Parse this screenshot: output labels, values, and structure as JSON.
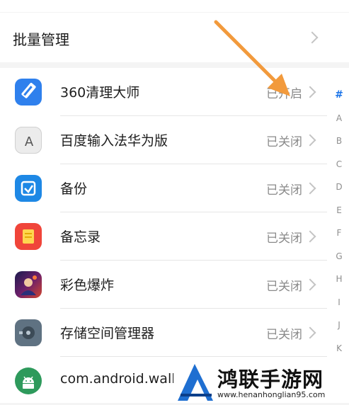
{
  "batch": {
    "label": "批量管理"
  },
  "apps": [
    {
      "name": "360清理大师",
      "status": "已开启",
      "icon": "broom-icon"
    },
    {
      "name": "百度输入法华为版",
      "status": "已关闭",
      "icon": "keyboard-a-icon"
    },
    {
      "name": "备份",
      "status": "已关闭",
      "icon": "backup-icon"
    },
    {
      "name": "备忘录",
      "status": "已关闭",
      "icon": "notepad-icon"
    },
    {
      "name": "彩色爆炸",
      "status": "已关闭",
      "icon": "game-icon"
    },
    {
      "name": "存储空间管理器",
      "status": "已关闭",
      "icon": "storage-icon"
    },
    {
      "name": "com.android.wall",
      "status": "",
      "icon": "android-icon"
    }
  ],
  "index_letters": [
    "#",
    "A",
    "B",
    "C",
    "D",
    "E",
    "F",
    "G",
    "H",
    "I",
    "J",
    "K"
  ],
  "watermark": {
    "text": "鸿联手游网",
    "url": "www.henanhonglian95.com"
  },
  "colors": {
    "arrow": "#f29a3c",
    "index_active": "#1a73e8",
    "status": "#8a8a8a"
  }
}
